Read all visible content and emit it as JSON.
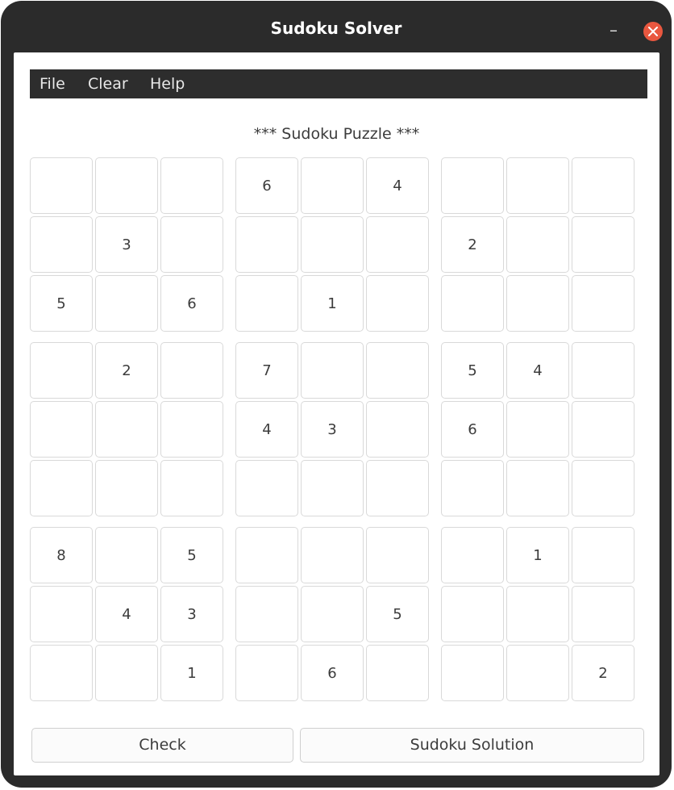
{
  "window": {
    "title": "Sudoku Solver"
  },
  "menu": [
    "File",
    "Clear",
    "Help"
  ],
  "puzzle_title": "***  Sudoku Puzzle  ***",
  "grid": [
    [
      "",
      "",
      "",
      "6",
      "",
      "4",
      "",
      "",
      ""
    ],
    [
      "",
      "3",
      "",
      "",
      "",
      "",
      "2",
      "",
      ""
    ],
    [
      "5",
      "",
      "6",
      "",
      "1",
      "",
      "",
      "",
      ""
    ],
    [
      "",
      "2",
      "",
      "7",
      "",
      "",
      "5",
      "4",
      ""
    ],
    [
      "",
      "",
      "",
      "4",
      "3",
      "",
      "6",
      "",
      ""
    ],
    [
      "",
      "",
      "",
      "",
      "",
      "",
      "",
      "",
      ""
    ],
    [
      "8",
      "",
      "5",
      "",
      "",
      "",
      "",
      "1",
      ""
    ],
    [
      "",
      "4",
      "3",
      "",
      "",
      "5",
      "",
      "",
      ""
    ],
    [
      "",
      "",
      "1",
      "",
      "6",
      "",
      "",
      "",
      "2"
    ]
  ],
  "buttons": {
    "check": "Check",
    "solution": "Sudoku Solution"
  },
  "colors": {
    "titlebar": "#2b2b2b",
    "close": "#e9573f"
  }
}
